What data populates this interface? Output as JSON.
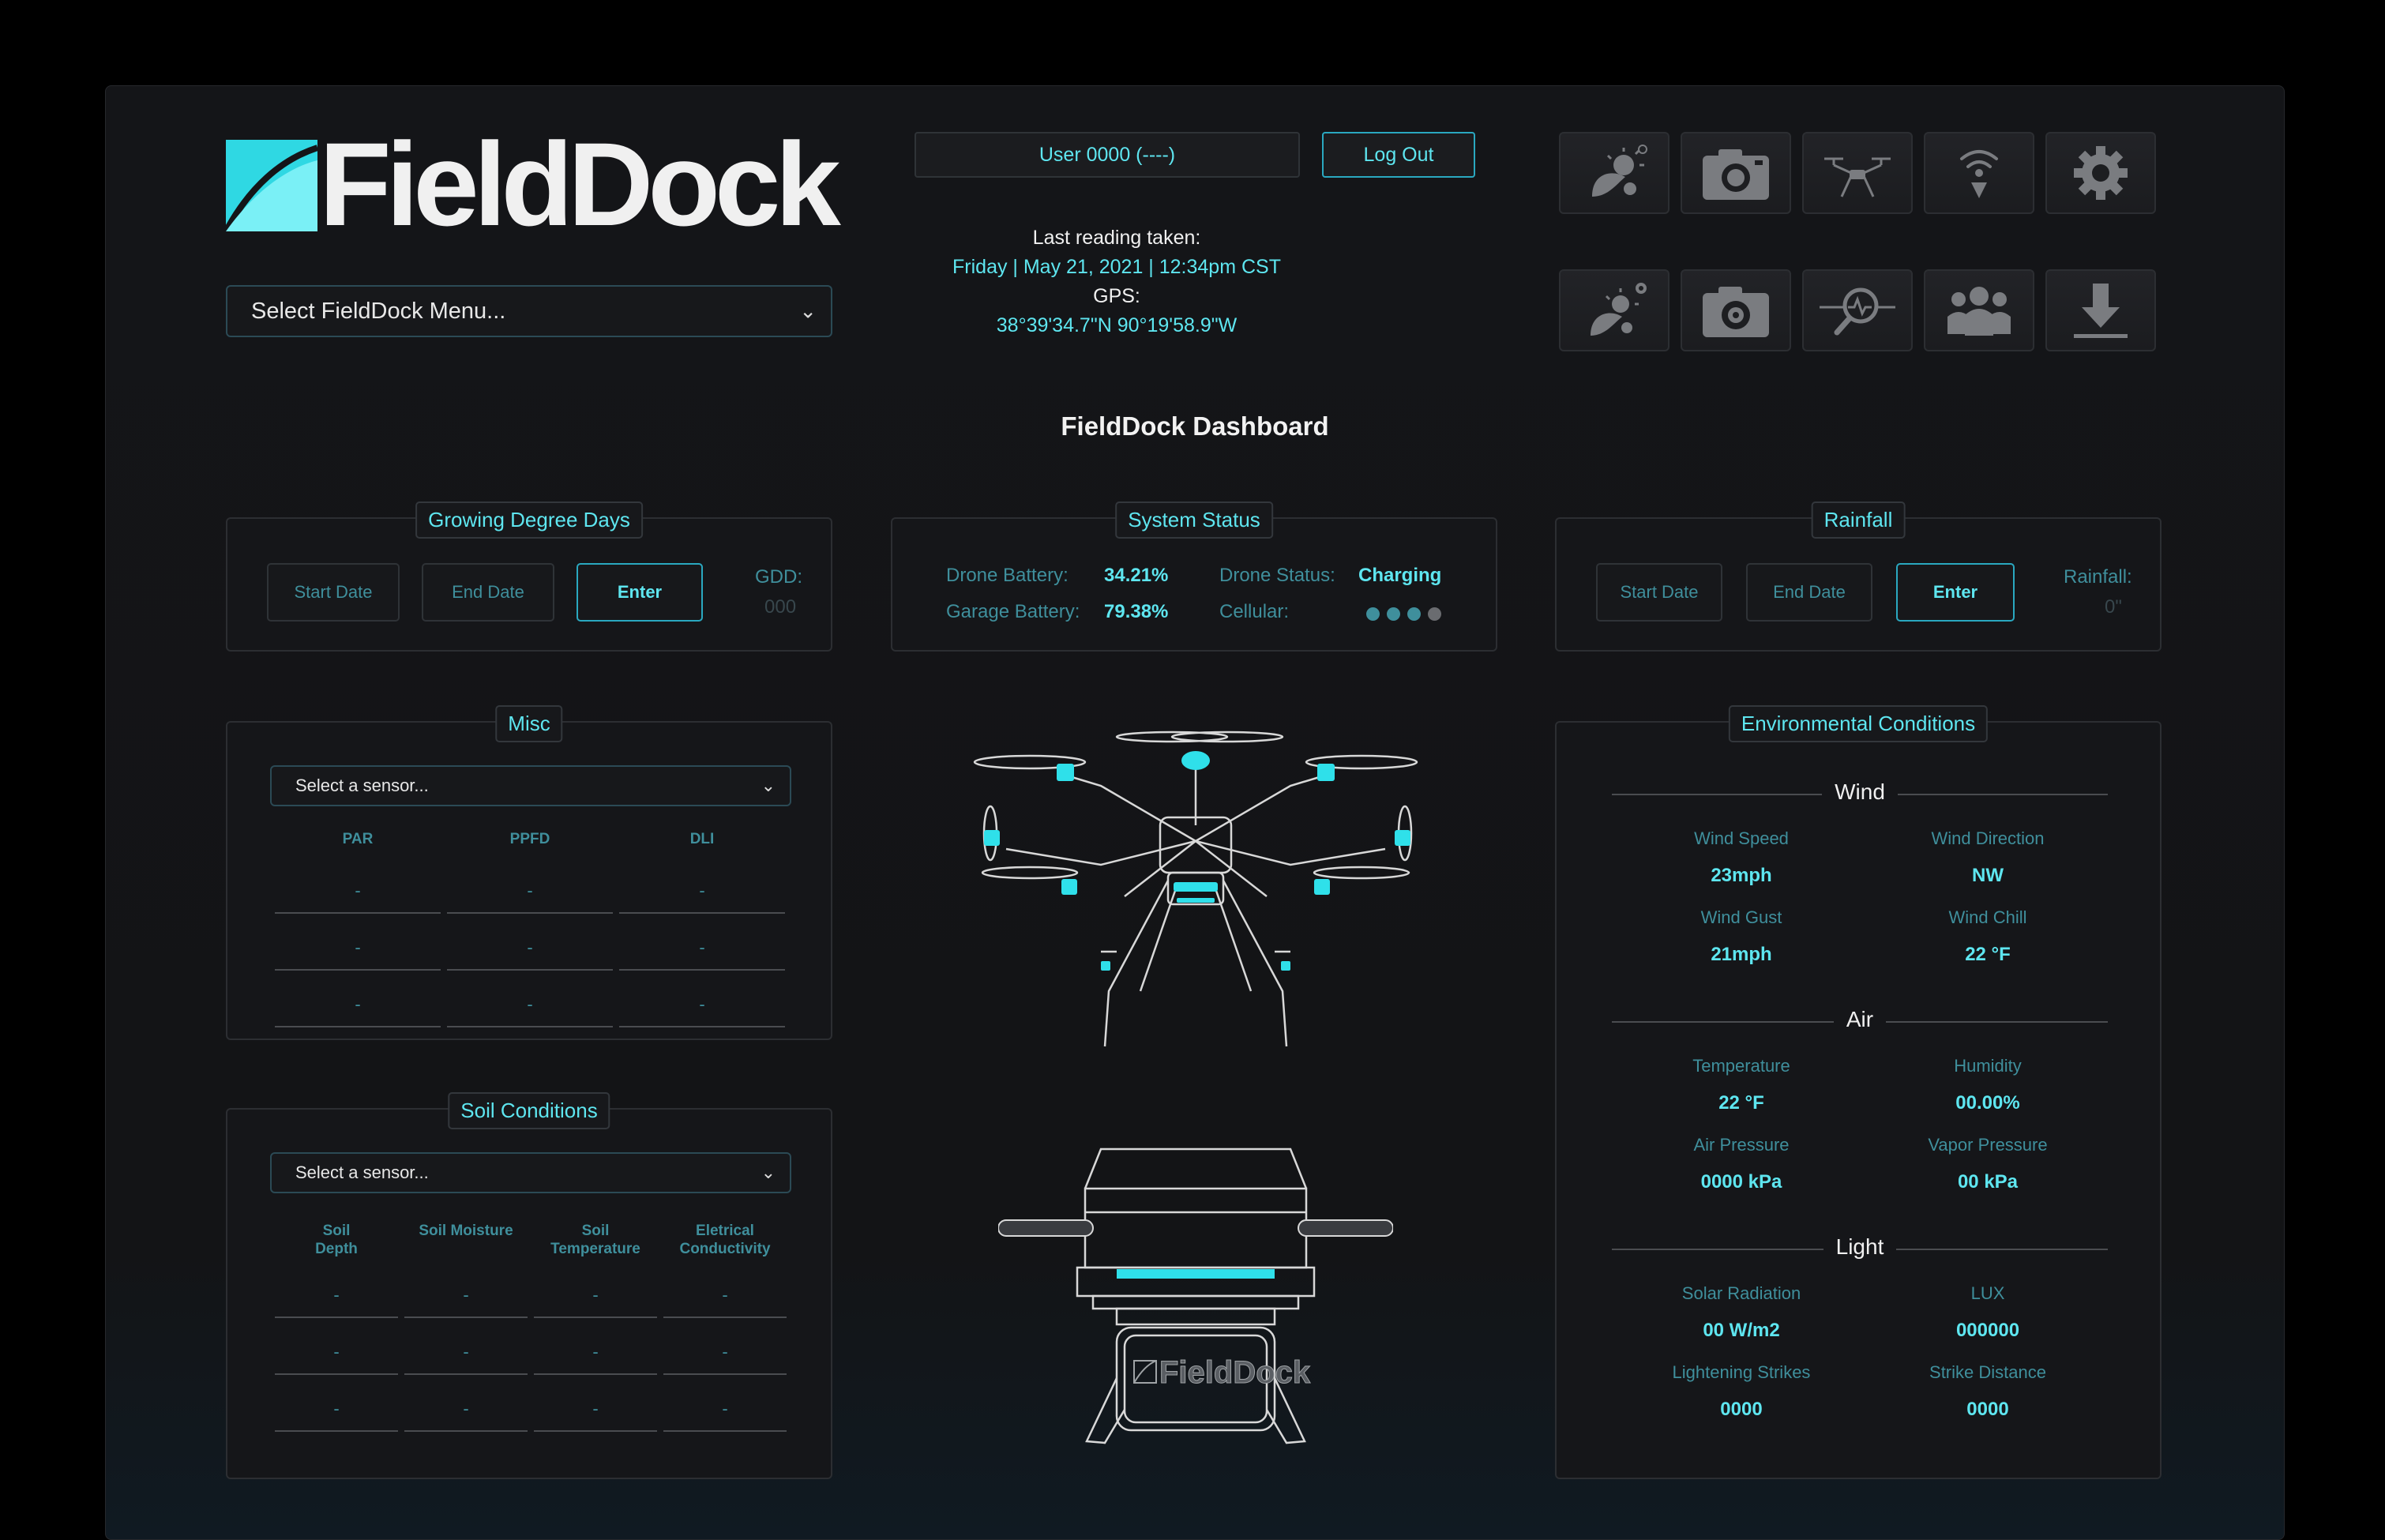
{
  "brand": {
    "name": "FieldDock"
  },
  "menu": {
    "selected": "Select FieldDock Menu..."
  },
  "header": {
    "user": "User 0000 (----)",
    "logout": "Log Out",
    "reading_label": "Last reading taken:",
    "reading_time": "Friday | May 21, 2021 | 12:34pm CST",
    "gps_label": "GPS:",
    "gps_value": "38°39'34.7\"N 90°19'58.9\"W"
  },
  "toolbar": {
    "row1": [
      "weather-icon",
      "camera-icon",
      "drone-icon",
      "wireless-icon",
      "settings-icon"
    ],
    "row2": [
      "weather-settings-icon",
      "camera-settings-icon",
      "sensor-analysis-icon",
      "users-icon",
      "download-icon"
    ]
  },
  "dashboard_title": "FieldDock Dashboard",
  "gdd": {
    "title": "Growing Degree Days",
    "start": "Start Date",
    "end": "End Date",
    "enter": "Enter",
    "label": "GDD:",
    "value": "000"
  },
  "system": {
    "title": "System Status",
    "drone_battery_label": "Drone Battery:",
    "drone_battery": "34.21%",
    "garage_battery_label": "Garage Battery:",
    "garage_battery": "79.38%",
    "drone_status_label": "Drone Status:",
    "drone_status": "Charging",
    "cellular_label": "Cellular:",
    "cellular_bars": 3,
    "cellular_max": 4
  },
  "rainfall": {
    "title": "Rainfall",
    "start": "Start Date",
    "end": "End Date",
    "enter": "Enter",
    "label": "Rainfall:",
    "value": "0\""
  },
  "misc": {
    "title": "Misc",
    "select": "Select a sensor...",
    "columns": [
      "PAR",
      "PPFD",
      "DLI"
    ],
    "rows": [
      [
        "-",
        "-",
        "-"
      ],
      [
        "-",
        "-",
        "-"
      ],
      [
        "-",
        "-",
        "-"
      ]
    ]
  },
  "soil": {
    "title": "Soil Conditions",
    "select": "Select a sensor...",
    "columns": [
      "Soil\nDepth",
      "Soil Moisture",
      "Soil\nTemperature",
      "Eletrical\nConductivity"
    ],
    "rows": [
      [
        "-",
        "-",
        "-",
        "-"
      ],
      [
        "-",
        "-",
        "-",
        "-"
      ],
      [
        "-",
        "-",
        "-",
        "-"
      ]
    ]
  },
  "dock_logo": "FieldDock",
  "env": {
    "title": "Environmental Conditions",
    "wind": {
      "label": "Wind",
      "speed_label": "Wind Speed",
      "speed": "23mph",
      "direction_label": "Wind Direction",
      "direction": "NW",
      "gust_label": "Wind Gust",
      "gust": "21mph",
      "chill_label": "Wind Chill",
      "chill": "22 °F"
    },
    "air": {
      "label": "Air",
      "temp_label": "Temperature",
      "temp": "22 °F",
      "humidity_label": "Humidity",
      "humidity": "00.00%",
      "pressure_label": "Air Pressure",
      "pressure": "0000 kPa",
      "vapor_label": "Vapor Pressure",
      "vapor": "00 kPa"
    },
    "light": {
      "label": "Light",
      "solar_label": "Solar Radiation",
      "solar": "00 W/m2",
      "lux_label": "LUX",
      "lux": "000000",
      "strikes_label": "Lightening Strikes",
      "strikes": "0000",
      "distance_label": "Strike Distance",
      "distance": "0000"
    }
  },
  "colors": {
    "accent": "#5ee6f0",
    "teal": "#3f8f9c",
    "bg": "#141518"
  }
}
